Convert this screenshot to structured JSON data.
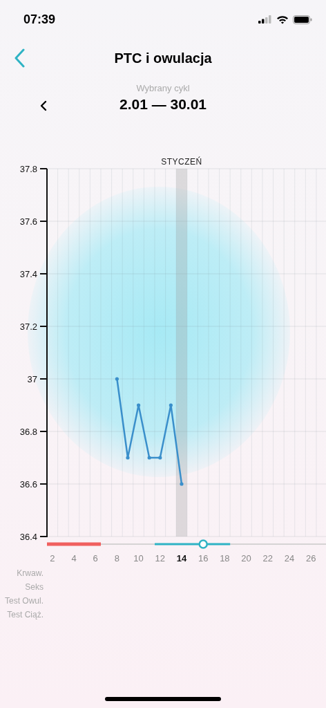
{
  "status_bar": {
    "time": "07:39"
  },
  "nav": {
    "title": "PTC i owulacja"
  },
  "cycle": {
    "caption": "Wybrany cykl",
    "range": "2.01 — 30.01"
  },
  "chart": {
    "month_label": "STYCZEŃ",
    "chart_data": {
      "type": "line",
      "grid": true,
      "xlim": [
        1.5,
        27.4
      ],
      "x": [
        8,
        9,
        10,
        11,
        12,
        13,
        14
      ],
      "series": [
        {
          "color": "#3a8fcb",
          "values": [
            37.0,
            36.7,
            36.9,
            36.7,
            36.7,
            36.9,
            36.6
          ]
        }
      ],
      "xticks": [
        2,
        4,
        6,
        8,
        10,
        12,
        14,
        16,
        18,
        20,
        22,
        24,
        26
      ],
      "ylim": [
        36.4,
        37.8
      ],
      "yticks": [
        36.4,
        36.6,
        36.8,
        {
          "value": 37,
          "label": "37"
        },
        37.2,
        37.4,
        37.6,
        37.8
      ],
      "bands": [
        {
          "axis": "x",
          "from": 13.5,
          "to": 14.5
        }
      ]
    }
  },
  "legend_rows": [
    "Krwaw.",
    "Seks",
    "Test Owul.",
    "Test Ciąż."
  ]
}
